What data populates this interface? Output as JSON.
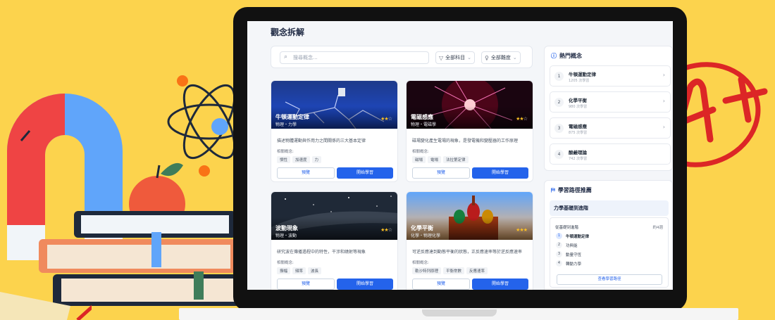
{
  "colors": {
    "background": "#fcd34d",
    "accent": "#2463eb",
    "star": "#fbbf24"
  },
  "page": {
    "title": "觀念拆解"
  },
  "search": {
    "placeholder": "搜尋概念...",
    "icon": "search-icon"
  },
  "filters": {
    "subject": {
      "label": "全部科目",
      "icon": "filter-icon"
    },
    "difficulty": {
      "label": "全部難度",
      "icon": "lightbulb-icon"
    }
  },
  "cards": [
    {
      "title": "牛頓運動定律",
      "subtitle": "物理・力學",
      "stars": 2,
      "description": "描述物體運動與作用力之間關係的三大基本定律",
      "related_label": "相關概念:",
      "tags": [
        "慣性",
        "加速度",
        "力"
      ],
      "preview_label": "預覽",
      "start_label": "開始學習"
    },
    {
      "title": "電磁感應",
      "subtitle": "物理・電磁學",
      "stars": 2,
      "description": "磁場變化產生電場的現象，是發電機和變壓器的工作原理",
      "related_label": "相關概念:",
      "tags": [
        "磁場",
        "電場",
        "法拉第定律"
      ],
      "preview_label": "預覽",
      "start_label": "開始學習"
    },
    {
      "title": "波動現象",
      "subtitle": "物理・波動",
      "stars": 2,
      "description": "研究波在傳播過程中的特性，干涉和繞射等現象",
      "related_label": "相關概念:",
      "tags": [
        "振幅",
        "頻率",
        "波長"
      ],
      "preview_label": "預覽",
      "start_label": "開始學習"
    },
    {
      "title": "化學平衡",
      "subtitle": "化學・物理化學",
      "stars": 3,
      "description": "可逆反應達到動態平衡的狀態，正反應速率等於逆反應速率",
      "related_label": "相關概念:",
      "tags": [
        "勒沙特列原理",
        "平衡常數",
        "反應速率"
      ],
      "preview_label": "預覽",
      "start_label": "開始學習"
    }
  ],
  "hot": {
    "title": "熱門概念",
    "items": [
      {
        "rank": "1",
        "name": "牛頓運動定律",
        "count": "1205 次學習"
      },
      {
        "rank": "2",
        "name": "化學平衡",
        "count": "980 次學習"
      },
      {
        "rank": "3",
        "name": "電磁感應",
        "count": "875 次學習"
      },
      {
        "rank": "4",
        "name": "酸鹼理論",
        "count": "742 次學習"
      }
    ]
  },
  "path": {
    "title": "學習路徑推薦",
    "name": "力學基礎到進階",
    "from_label": "從基礎到進階",
    "weeks": "約4週",
    "steps": [
      {
        "n": "1",
        "label": "牛頓運動定律"
      },
      {
        "n": "2",
        "label": "功與能"
      },
      {
        "n": "3",
        "label": "動量守恆"
      },
      {
        "n": "4",
        "label": "轉動力學"
      }
    ],
    "button": "查看學習路徑"
  }
}
